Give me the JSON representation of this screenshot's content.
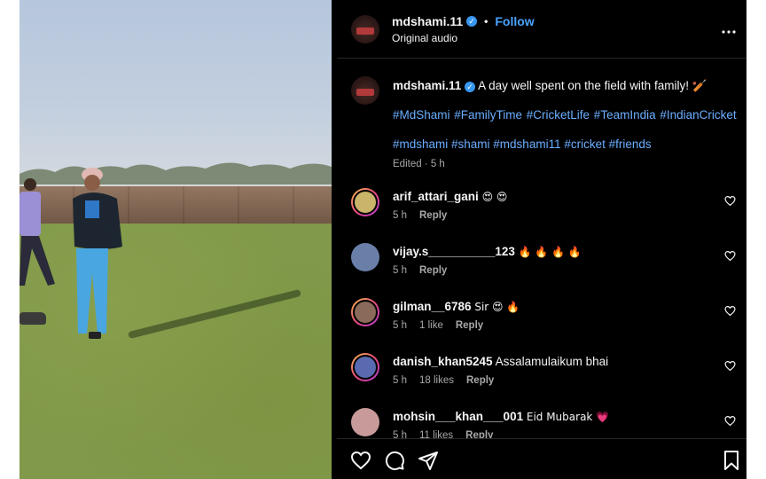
{
  "post": {
    "username": "mdshami.11",
    "verified_mark": "✓",
    "separator": "•",
    "follow_label": "Follow",
    "audio": "Original audio",
    "more_icon": "more-options-icon",
    "caption": {
      "text": "A day well spent on the field with family! 🏏",
      "tags_line1": "#MdShami #FamilyTime #CricketLife #TeamIndia #IndianCricket",
      "tags_line2": "#mdshami #shami #mdshami11 #cricket #friends",
      "edited": "Edited · 5 h"
    }
  },
  "comments": [
    {
      "user": "arif_attari_gani",
      "text": "😍 😍",
      "time": "5 h",
      "likes": "",
      "reply": "Reply",
      "avatar_color": "#c9b46a"
    },
    {
      "user": "vijay.s__________123",
      "text": "🔥 🔥 🔥 🔥",
      "time": "5 h",
      "likes": "",
      "reply": "Reply",
      "avatar_color": "#6a7fa8"
    },
    {
      "user": "gilman__6786",
      "text": "Sir 😍 🔥",
      "time": "5 h",
      "likes": "1 like",
      "reply": "Reply",
      "avatar_color": "#8a6a5a"
    },
    {
      "user": "danish_khan5245",
      "text": "Assalamulaikum bhai",
      "time": "5 h",
      "likes": "18 likes",
      "reply": "Reply",
      "avatar_color": "#5a6ab0"
    },
    {
      "user": "mohsin___khan___001",
      "text": "Eid Mubarak 💗",
      "time": "5 h",
      "likes": "11 likes",
      "reply": "Reply",
      "avatar_color": "#c89a9a"
    }
  ],
  "colors": {
    "panel_bg": "#000000",
    "link_blue": "#6aaeff",
    "follow_blue": "#4aa3ff",
    "muted": "#a8a8a8",
    "verified": "#3897f0"
  },
  "icons": [
    "heart-icon",
    "comment-icon",
    "share-icon",
    "bookmark-icon"
  ]
}
